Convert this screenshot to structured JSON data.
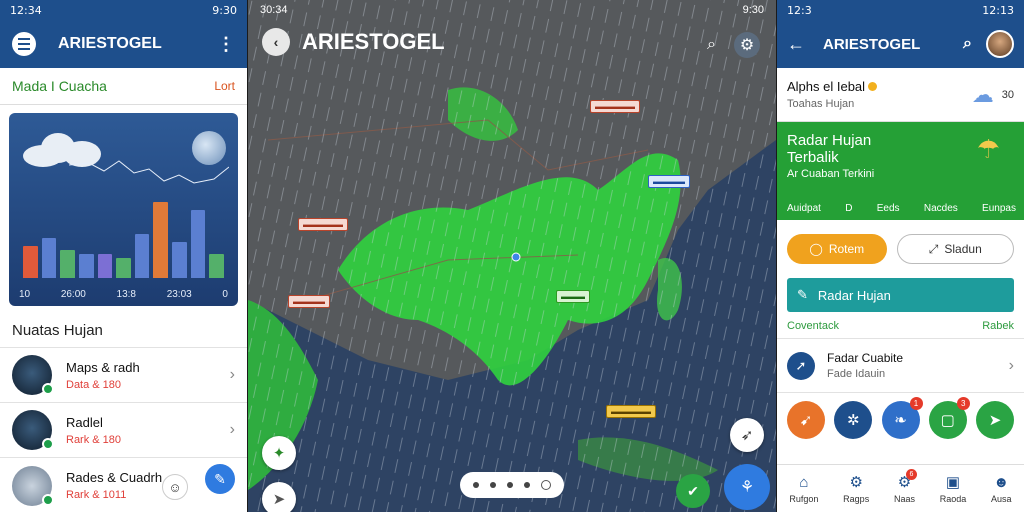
{
  "left": {
    "status_time": "12:34",
    "status_right": "9:30",
    "app_title": "ARIESTOGEL",
    "subheader_title": "Mada I Cuacha",
    "subheader_action": "Lort",
    "card_ticks": [
      "10",
      "26:00",
      "13:8",
      "23:03",
      "0"
    ],
    "bar_values": [
      0.4,
      0.5,
      0.35,
      0.3,
      0.3,
      0.25,
      0.55,
      0.95,
      0.45,
      0.85,
      0.3
    ],
    "bar_colors": [
      "#e05a3a",
      "#5b7fd1",
      "#54b06a",
      "#5b7fd1",
      "#7c6fd4",
      "#54b06a",
      "#5b7fd1",
      "#e07a38",
      "#5b7fd1",
      "#5b7fd1",
      "#54b06a"
    ],
    "section_title": "Nuatas Hujan",
    "items": [
      {
        "name": "Maps & radh",
        "sub": "Data & 180"
      },
      {
        "name": "Radlel",
        "sub": "Rark & 180"
      },
      {
        "name": "Rades & Cuadrh",
        "sub": "Rark & 1011"
      }
    ]
  },
  "map": {
    "status_time": "30:34",
    "status_right": "9:30",
    "title": "ARIESTOGEL",
    "tags": [
      {
        "text": "▬▬▬▬▬",
        "kind": "red"
      },
      {
        "text": "▬▬▬▬",
        "kind": "blue"
      },
      {
        "text": "▬▬▬▬▬",
        "kind": "red"
      },
      {
        "text": "▬▬▬▬",
        "kind": "red"
      },
      {
        "text": "▬▬▬",
        "kind": "green"
      },
      {
        "text": "▬▬▬▬▬",
        "kind": "yellow"
      }
    ]
  },
  "right": {
    "status_time": "12:3",
    "status_right": "12:13",
    "app_title": "ARIESTOGEL",
    "alert_title": "Alphs el Iebal",
    "alert_sub": "Toahas Hujan",
    "alert_temp": "30",
    "card_title1": "Radar Hujan",
    "card_title2": "Terbalik",
    "card_sub": "Ar Cuaban Terkini",
    "card_foot": [
      "Auidpat",
      "D",
      "Eeds",
      "Nacdes",
      "Eunpas"
    ],
    "pill_left": "Rotem",
    "pill_right": "Sladun",
    "teal_label": "Radar Hujan",
    "link_left": "Coventack",
    "link_right": "Rabek",
    "radar_title": "Fadar Cuabite",
    "radar_sub": "Fade Idauin",
    "circle_badges": [
      "",
      "",
      "1",
      "3",
      ""
    ],
    "colors": {
      "c1": "#e8732a",
      "c2": "#1e4f8c",
      "c3": "#2f6fc9",
      "c4": "#2aa444",
      "c5": "#2aa444"
    },
    "nav": [
      {
        "label": "Rufgon",
        "badge": ""
      },
      {
        "label": "Ragps",
        "badge": ""
      },
      {
        "label": "Naas",
        "badge": "6"
      },
      {
        "label": "Raoda",
        "badge": ""
      },
      {
        "label": "Ausa",
        "badge": ""
      }
    ]
  }
}
